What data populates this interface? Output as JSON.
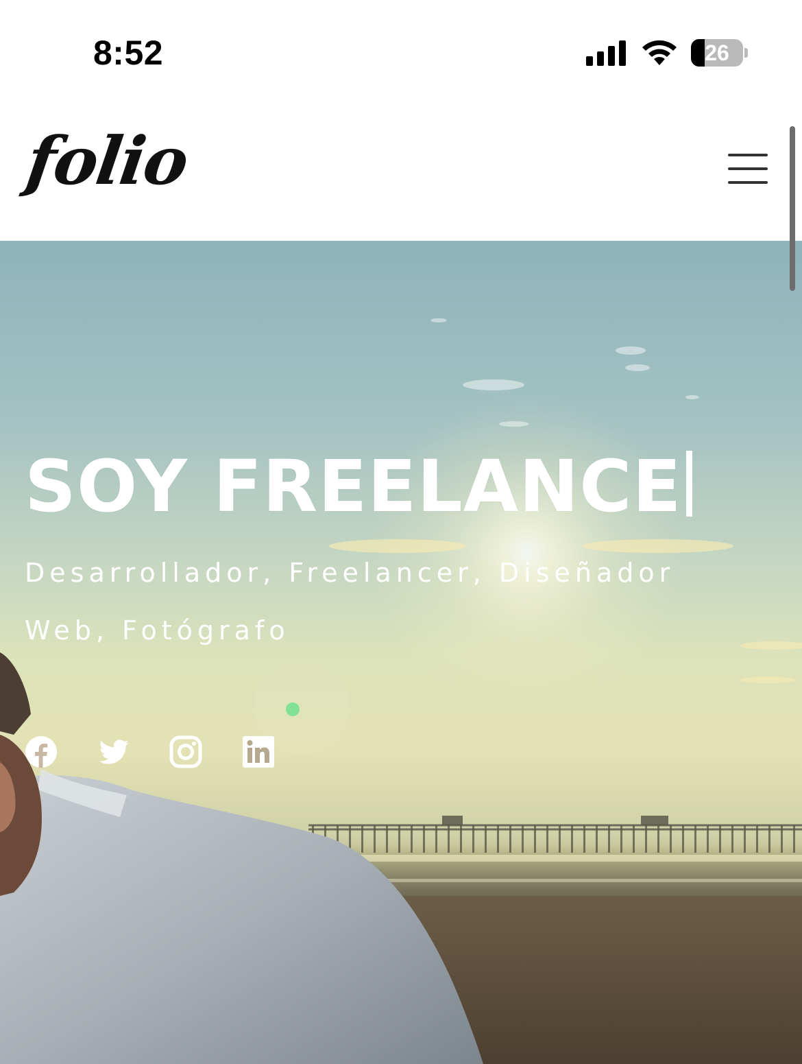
{
  "status_bar": {
    "time": "8:52",
    "battery_level": "26",
    "battery_fraction": 0.26,
    "icons": [
      "cellular-signal-icon",
      "wifi-icon",
      "battery-icon"
    ]
  },
  "header": {
    "logo_text": "folio",
    "menu_icon": "hamburger-menu-icon"
  },
  "hero": {
    "title": "SOY FREELANCE",
    "subtitle": "Desarrollador, Freelancer, Diseñador Web, Fotógrafo",
    "socials": [
      {
        "icon": "facebook-icon"
      },
      {
        "icon": "twitter-icon"
      },
      {
        "icon": "instagram-icon"
      },
      {
        "icon": "linkedin-icon"
      }
    ]
  },
  "colors": {
    "text_on_hero": "#ffffff",
    "logo": "#111111",
    "menu_lines": "#333333"
  }
}
